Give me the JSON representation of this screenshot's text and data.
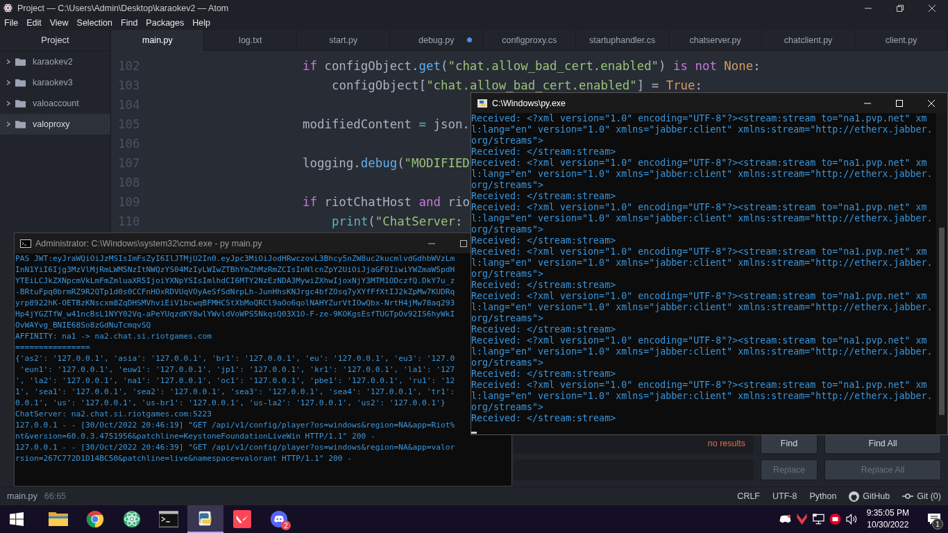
{
  "atom": {
    "title": "Project — C:\\Users\\Admin\\Desktop\\karaokev2 — Atom",
    "menu": [
      "File",
      "Edit",
      "View",
      "Selection",
      "Find",
      "Packages",
      "Help"
    ],
    "sidebar": {
      "title": "Project",
      "items": [
        {
          "label": "karaokev2",
          "selected": false
        },
        {
          "label": "karaokev3",
          "selected": false
        },
        {
          "label": "valoaccount",
          "selected": false
        },
        {
          "label": "valoproxy",
          "selected": true
        }
      ]
    },
    "tabs": [
      {
        "label": "main.py",
        "selected": true,
        "modified": false
      },
      {
        "label": "log.txt",
        "selected": false,
        "modified": false
      },
      {
        "label": "start.py",
        "selected": false,
        "modified": false
      },
      {
        "label": "debug.py",
        "selected": false,
        "modified": true
      },
      {
        "label": "configproxy.cs",
        "selected": false,
        "modified": false
      },
      {
        "label": "startuphandler.cs",
        "selected": false,
        "modified": false
      },
      {
        "label": "chatserver.py",
        "selected": false,
        "modified": false
      },
      {
        "label": "chatclient.py",
        "selected": false,
        "modified": false
      },
      {
        "label": "client.py",
        "selected": false,
        "modified": false
      }
    ],
    "code": [
      {
        "number": "102",
        "kind": "statement",
        "tokens": [
          {
            "text": "if",
            "kind": "keyword"
          },
          {
            "text": " configObject.",
            "kind": "plain"
          },
          {
            "text": "get",
            "kind": "function"
          },
          {
            "text": "(",
            "kind": "plain"
          },
          {
            "text": "\"chat.allow_bad_cert.enabled\"",
            "kind": "string"
          },
          {
            "text": ") ",
            "kind": "plain"
          },
          {
            "text": "is not",
            "kind": "keyword"
          },
          {
            "text": " None",
            "kind": "constant"
          },
          {
            "text": ":",
            "kind": "plain"
          }
        ]
      },
      {
        "number": "103",
        "kind": "body",
        "tokens": [
          {
            "text": "configObject[",
            "kind": "plain"
          },
          {
            "text": "\"chat.allow_bad_cert.enabled\"",
            "kind": "string"
          },
          {
            "text": "] = ",
            "kind": "plain"
          },
          {
            "text": "True",
            "kind": "constant"
          },
          {
            "text": ":",
            "kind": "plain"
          }
        ]
      },
      {
        "number": "104",
        "kind": "blank"
      },
      {
        "number": "105",
        "kind": "statement",
        "tokens": [
          {
            "text": "modifiedContent ",
            "kind": "plain"
          },
          {
            "text": "=",
            "kind": "operator"
          },
          {
            "text": " json.",
            "kind": "plain"
          }
        ]
      },
      {
        "number": "106",
        "kind": "blank"
      },
      {
        "number": "107",
        "kind": "statement",
        "tokens": [
          {
            "text": "logging.",
            "kind": "plain"
          },
          {
            "text": "debug",
            "kind": "function"
          },
          {
            "text": "(",
            "kind": "plain"
          },
          {
            "text": "\"MODIFIED",
            "kind": "string"
          }
        ]
      },
      {
        "number": "108",
        "kind": "blank"
      },
      {
        "number": "109",
        "kind": "statement",
        "tokens": [
          {
            "text": "if",
            "kind": "keyword"
          },
          {
            "text": " riotChatHost ",
            "kind": "plain"
          },
          {
            "text": "and",
            "kind": "keyword"
          },
          {
            "text": " rio",
            "kind": "plain"
          }
        ]
      },
      {
        "number": "110",
        "kind": "body",
        "tokens": [
          {
            "text": "print",
            "kind": "operator"
          },
          {
            "text": "(",
            "kind": "plain"
          },
          {
            "text": "\"ChatServer: ",
            "kind": "string"
          }
        ]
      }
    ],
    "find": {
      "status": "no results",
      "rows": [
        {
          "buttons": [
            {
              "label": "Find",
              "disabled": false
            },
            {
              "label": "Find All",
              "disabled": false
            }
          ]
        },
        {
          "buttons": [
            {
              "label": "Replace",
              "disabled": true
            },
            {
              "label": "Replace All",
              "disabled": true
            }
          ]
        }
      ]
    },
    "status_bar": {
      "file": "main.py",
      "cursor": "66:65",
      "items": [
        {
          "label": "CRLF",
          "kind": "text"
        },
        {
          "label": "UTF-8",
          "kind": "text"
        },
        {
          "label": "Python",
          "kind": "text"
        },
        {
          "label": "GitHub",
          "kind": "github"
        },
        {
          "label": "Git (0)",
          "kind": "git"
        }
      ]
    }
  },
  "py_window": {
    "title": "C:\\Windows\\py.exe",
    "lines": [
      "Received: <?xml version=\"1.0\" encoding=\"UTF-8\"?><stream:stream to=\"na1.pvp.net\" xml:lang=\"en\" version=\"1.0\" xmlns=\"jabber:client\" xmlns:stream=\"http://etherx.jabber.org/streams\">",
      "Received: </stream:stream>",
      "Received: <?xml version=\"1.0\" encoding=\"UTF-8\"?><stream:stream to=\"na1.pvp.net\" xml:lang=\"en\" version=\"1.0\" xmlns=\"jabber:client\" xmlns:stream=\"http://etherx.jabber.org/streams\">",
      "Received: </stream:stream>",
      "Received: <?xml version=\"1.0\" encoding=\"UTF-8\"?><stream:stream to=\"na1.pvp.net\" xml:lang=\"en\" version=\"1.0\" xmlns=\"jabber:client\" xmlns:stream=\"http://etherx.jabber.org/streams\">",
      "Received: </stream:stream>",
      "Received: <?xml version=\"1.0\" encoding=\"UTF-8\"?><stream:stream to=\"na1.pvp.net\" xml:lang=\"en\" version=\"1.0\" xmlns=\"jabber:client\" xmlns:stream=\"http://etherx.jabber.org/streams\">",
      "Received: </stream:stream>",
      "Received: <?xml version=\"1.0\" encoding=\"UTF-8\"?><stream:stream to=\"na1.pvp.net\" xml:lang=\"en\" version=\"1.0\" xmlns=\"jabber:client\" xmlns:stream=\"http://etherx.jabber.org/streams\">",
      "Received: </stream:stream>",
      "Received: <?xml version=\"1.0\" encoding=\"UTF-8\"?><stream:stream to=\"na1.pvp.net\" xml:lang=\"en\" version=\"1.0\" xmlns=\"jabber:client\" xmlns:stream=\"http://etherx.jabber.org/streams\">",
      "Received: </stream:stream>",
      "Received: <?xml version=\"1.0\" encoding=\"UTF-8\"?><stream:stream to=\"na1.pvp.net\" xml:lang=\"en\" version=\"1.0\" xmlns=\"jabber:client\" xmlns:stream=\"http://etherx.jabber.org/streams\">",
      "Received: </stream:stream>"
    ]
  },
  "cmd_window": {
    "title": "Administrator: C:\\Windows\\system32\\cmd.exe - py  main.py",
    "lines": [
      "PAS JWT:eyJraWQiOiJzMSIsImFsZyI6IlJTMjU2In0.eyJpc3MiOiJodHRwczovL3Bhcy5nZW8uc2kucmlvdGdhbWVzLm",
      "InN1YiI6Ijg3MzVlMjRmLWM5NzItNWQzYS04MzIyLWIwZTBhYmZhMzRmZCIsInNlcnZpY2UiOiJjaGF0IiwiYWZmaW5pdH",
      "YTEiLCJkZXNpcmVkLmFmZmluaXR5IjoiYXNpYSIsImlhdCI6MTY2NzEzNDA3MywiZXhwIjoxNjY3MTM1ODczfQ.DkY7u_z",
      "-BRtuFpq0brmRZ9R2QTp1d0s0CCFnHOxRDVUqVOyAeSfSdNrpLh-JunHhsKNJrgc4bfZOsq7yXYfFfXtIJ2kZpMw7KUDRq",
      "yrp8922hK-OETBzKNscxm8ZqDHSMVhviEiV1bcwqBFMHCStXbMoQRCl9aOo6qolNAHYZurVtIOwQbx-NrtH4jMw78aq293",
      "Hp4jYGZTfW_w41ncBsL1NYY02Vq-aPeYUqzdKY8wlYWvldVoWPS5NkqsQ03X1O-F-ze-9KOKgsEsfTUGTpOv92IS6hyWkI",
      "OvWAYvg_BNIE68So8zGdNuTcmqvSQ",
      "AFFINITY: na1 -> na2.chat.si.riotgames.com",
      "================",
      "{'as2': '127.0.0.1', 'asia': '127.0.0.1', 'br1': '127.0.0.1', 'eu': '127.0.0.1', 'eu3': '127.0",
      " 'eun1': '127.0.0.1', 'euw1': '127.0.0.1', 'jp1': '127.0.0.1', 'kr1': '127.0.0.1', 'la1': '127",
      "', 'la2': '127.0.0.1', 'na1': '127.0.0.1', 'oc1': '127.0.0.1', 'pbe1': '127.0.0.1', 'ru1': '12",
      "1', 'sea1': '127.0.0.1', 'sea2': '127.0.0.1', 'sea3': '127.0.0.1', 'sea4': '127.0.0.1', 'tr1':",
      "0.0.1', 'us': '127.0.0.1', 'us-br1': '127.0.0.1', 'us-la2': '127.0.0.1', 'us2': '127.0.0.1'}",
      "ChatServer: na2.chat.si.riotgames.com:5223",
      "127.0.0.1 - - [30/Oct/2022 20:46:19] \"GET /api/v1/config/player?os=windows&region=NA&app=Riot%",
      "nt&version=60.0.3.4751956&patchline=KeystoneFoundationLiveWin HTTP/1.1\" 200 -",
      "127.0.0.1 - - [30/Oct/2022 20:46:39] \"GET /api/v1/config/player?os=windows&region=NA&app=valor",
      "rsion=267C772D1D14BC50&patchline=live&namespace=valorant HTTP/1.1\" 200 -"
    ]
  },
  "taskbar": {
    "apps": [
      {
        "kind": "folder",
        "selected": false
      },
      {
        "kind": "chrome",
        "selected": false
      },
      {
        "kind": "atom",
        "selected": false
      },
      {
        "kind": "terminal",
        "selected": false
      },
      {
        "kind": "python",
        "selected": true
      },
      {
        "kind": "valorant",
        "selected": false
      },
      {
        "kind": "discord",
        "selected": false,
        "badge": "2"
      }
    ],
    "time": "9:35:05 PM",
    "date": "10/30/2022",
    "notifications": "1"
  }
}
